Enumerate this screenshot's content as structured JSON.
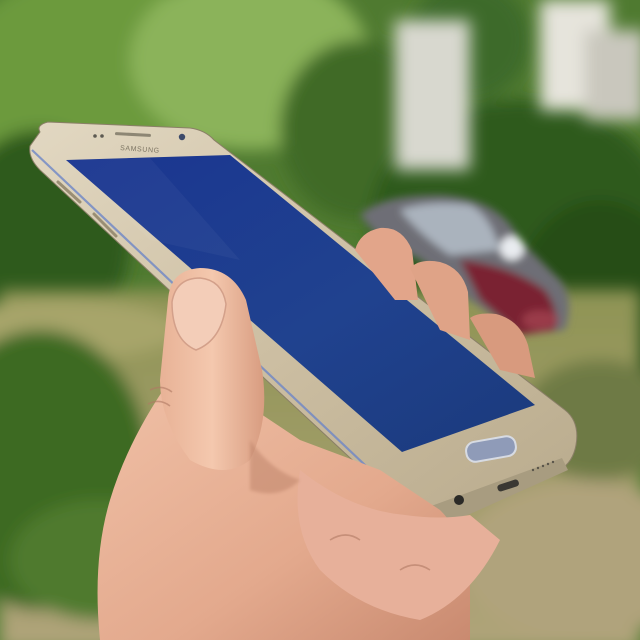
{
  "photo": {
    "subject": "hand-holding-smartphone",
    "phone": {
      "brand_text": "SAMSUNG",
      "body_color": "#cfc3a8",
      "screen_color": "#1e3d8f",
      "screen_state": "off"
    },
    "colors": {
      "foliage_dark": "#2f5a1e",
      "foliage_light": "#7fae4a",
      "ground": "#9f9a62",
      "skin": "#e7b39a",
      "car_red": "#7a2230"
    }
  }
}
